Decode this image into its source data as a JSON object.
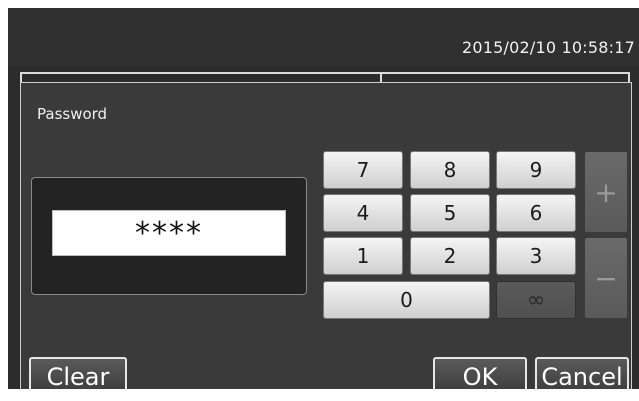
{
  "status": {
    "datetime": "2015/02/10  10:58:17"
  },
  "dialog": {
    "title": "Password",
    "password_mask": "****"
  },
  "keypad": {
    "row1": [
      "7",
      "8",
      "9"
    ],
    "row2": [
      "4",
      "5",
      "6"
    ],
    "row3": [
      "1",
      "2",
      "3"
    ],
    "zero": "0",
    "infinity": "∞",
    "plus": "+",
    "minus": "−"
  },
  "buttons": {
    "clear": "Clear",
    "ok": "OK",
    "cancel": "Cancel"
  }
}
